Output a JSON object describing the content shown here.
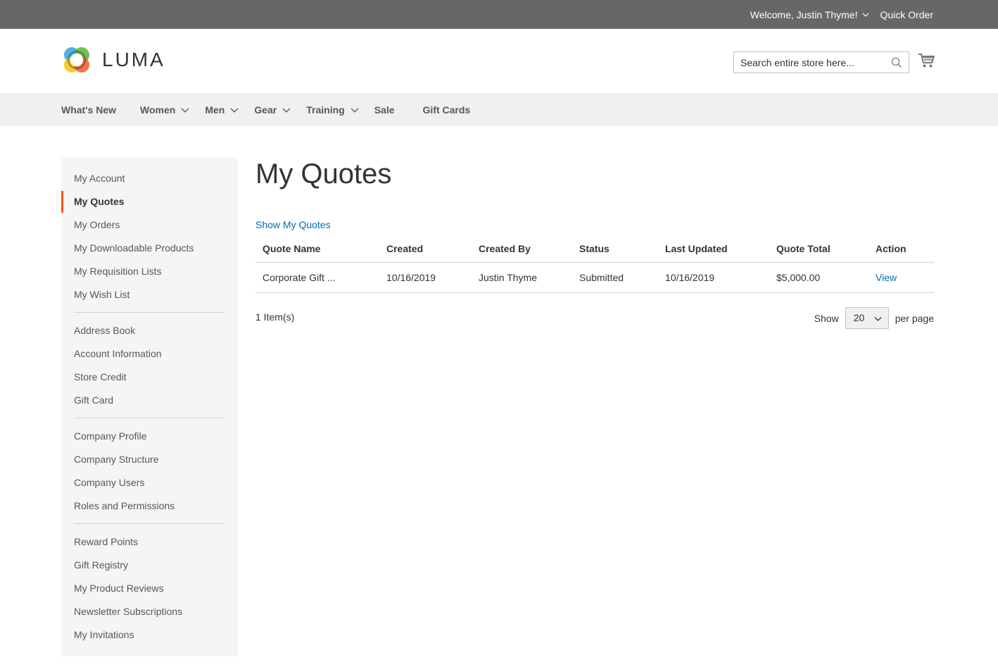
{
  "top_bar": {
    "welcome": "Welcome, Justin Thyme!",
    "quick_order": "Quick Order"
  },
  "header": {
    "logo_text": "LUMA",
    "search_placeholder": "Search entire store here..."
  },
  "nav": {
    "items": [
      {
        "label": "What's New",
        "has_submenu": false
      },
      {
        "label": "Women",
        "has_submenu": true
      },
      {
        "label": "Men",
        "has_submenu": true
      },
      {
        "label": "Gear",
        "has_submenu": true
      },
      {
        "label": "Training",
        "has_submenu": true
      },
      {
        "label": "Sale",
        "has_submenu": false
      },
      {
        "label": "Gift Cards",
        "has_submenu": false
      }
    ]
  },
  "sidebar": {
    "groups": [
      [
        "My Account",
        "My Quotes",
        "My Orders",
        "My Downloadable Products",
        "My Requisition Lists",
        "My Wish List"
      ],
      [
        "Address Book",
        "Account Information",
        "Store Credit",
        "Gift Card"
      ],
      [
        "Company Profile",
        "Company Structure",
        "Company Users",
        "Roles and Permissions"
      ],
      [
        "Reward Points",
        "Gift Registry",
        "My Product Reviews",
        "Newsletter Subscriptions",
        "My Invitations"
      ]
    ],
    "active": "My Quotes"
  },
  "main": {
    "title": "My Quotes",
    "show_link": "Show My Quotes",
    "table": {
      "headers": [
        "Quote Name",
        "Created",
        "Created By",
        "Status",
        "Last Updated",
        "Quote Total",
        "Action"
      ],
      "rows": [
        [
          "Corporate Gift ...",
          "10/16/2019",
          "Justin Thyme",
          "Submitted",
          "10/16/2019",
          "$5,000.00",
          "View"
        ]
      ]
    },
    "items_count": "1 Item(s)",
    "limiter": {
      "show": "Show",
      "value": "20",
      "per_page": "per page"
    }
  },
  "colors": {
    "top_bar": "#676865",
    "nav_bg": "#f0f0f0",
    "sidebar_bg": "#f5f5f5",
    "active_marker": "#ff5501",
    "link": "#006bb4"
  }
}
